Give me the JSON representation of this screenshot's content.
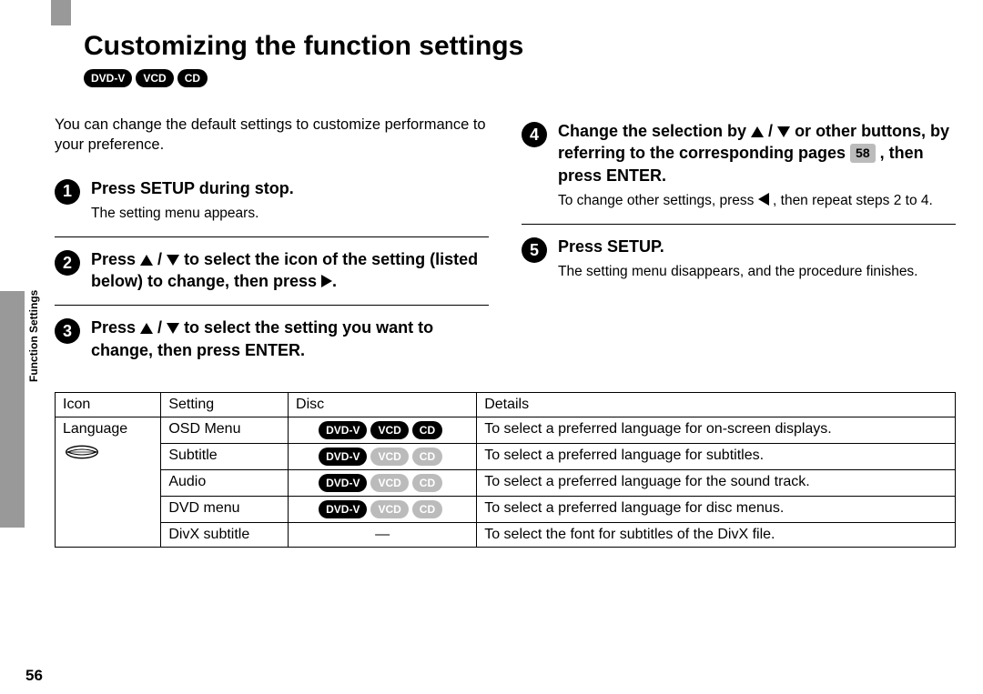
{
  "side_label": "Function Settings",
  "page_number": "56",
  "title": "Customizing the function settings",
  "title_badges": [
    "DVD-V",
    "VCD",
    "CD"
  ],
  "intro": "You can change the default settings to customize performance to your preference.",
  "steps": {
    "s1": {
      "num": "1",
      "title": "Press SETUP during stop.",
      "body": "The setting menu appears."
    },
    "s2": {
      "num": "2",
      "title_a": "Press ",
      "title_b": " / ",
      "title_c": " to select the icon of the setting (listed below) to change, then press ",
      "title_d": "."
    },
    "s3": {
      "num": "3",
      "title_a": "Press ",
      "title_b": " / ",
      "title_c": " to select the setting you want to change, then press ENTER."
    },
    "s4": {
      "num": "4",
      "title_a": "Change the selection by ",
      "title_b": " / ",
      "title_c": " or other buttons, by referring to the corresponding pages ",
      "pageref": "58",
      "title_d": " , then press ENTER.",
      "body_a": "To change other settings, press ",
      "body_b": " , then repeat steps 2 to 4."
    },
    "s5": {
      "num": "5",
      "title": "Press SETUP.",
      "body": "The setting menu disappears, and the procedure finishes."
    }
  },
  "table": {
    "headers": [
      "Icon",
      "Setting",
      "Disc",
      "Details"
    ],
    "icon_label": "Language",
    "rows": [
      {
        "setting": "OSD Menu",
        "discs": [
          {
            "label": "DVD-V",
            "on": true
          },
          {
            "label": "VCD",
            "on": true
          },
          {
            "label": "CD",
            "on": true
          }
        ],
        "details": "To select a preferred language for on-screen displays."
      },
      {
        "setting": "Subtitle",
        "discs": [
          {
            "label": "DVD-V",
            "on": true
          },
          {
            "label": "VCD",
            "on": false
          },
          {
            "label": "CD",
            "on": false
          }
        ],
        "details": "To select a preferred language for subtitles."
      },
      {
        "setting": "Audio",
        "discs": [
          {
            "label": "DVD-V",
            "on": true
          },
          {
            "label": "VCD",
            "on": false
          },
          {
            "label": "CD",
            "on": false
          }
        ],
        "details": "To select a preferred language for the sound track."
      },
      {
        "setting": "DVD menu",
        "discs": [
          {
            "label": "DVD-V",
            "on": true
          },
          {
            "label": "VCD",
            "on": false
          },
          {
            "label": "CD",
            "on": false
          }
        ],
        "details": "To select a preferred language for disc menus."
      },
      {
        "setting": "DivX subtitle",
        "discs": null,
        "dash": "—",
        "details": "To select the font for subtitles of the DivX file."
      }
    ]
  }
}
